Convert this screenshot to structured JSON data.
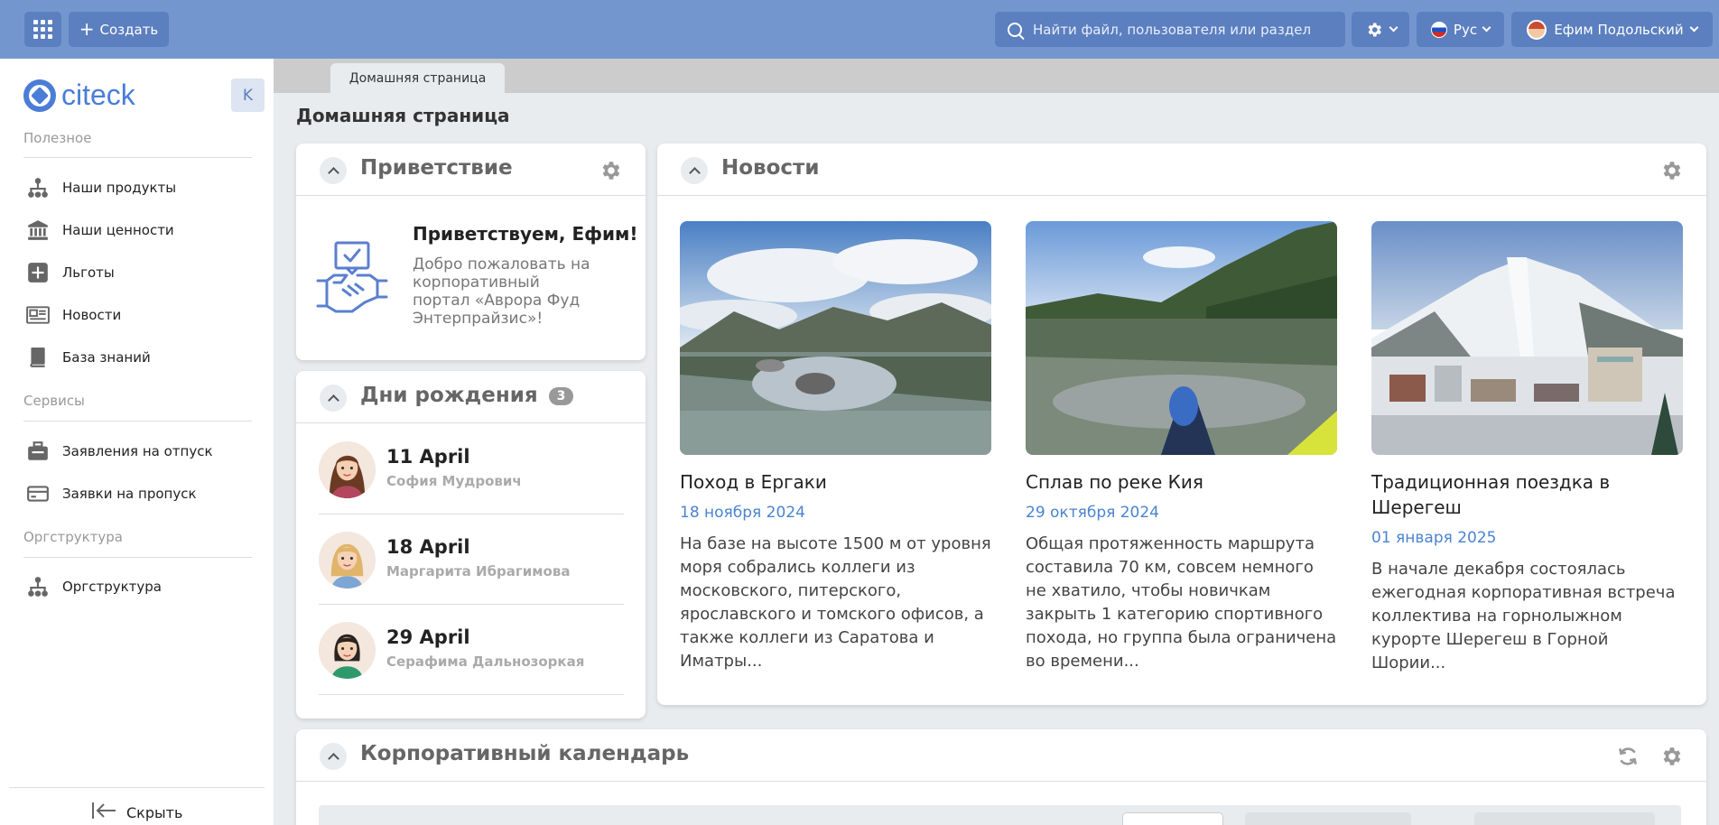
{
  "topbar": {
    "create_label": "Создать",
    "search_placeholder": "Найти файл, пользователя или раздел",
    "language": "Рус",
    "user_name": "Ефим Подольский"
  },
  "sidebar": {
    "logo_text": "citeck",
    "collapse_letter": "K",
    "sections": [
      {
        "title": "Полезное",
        "items": [
          {
            "label": "Наши продукты",
            "icon": "org-structure-icon"
          },
          {
            "label": "Наши ценности",
            "icon": "bank-icon"
          },
          {
            "label": "Льготы",
            "icon": "plus-square-icon"
          },
          {
            "label": "Новости",
            "icon": "newspaper-icon"
          },
          {
            "label": "База знаний",
            "icon": "book-icon"
          }
        ]
      },
      {
        "title": "Сервисы",
        "items": [
          {
            "label": "Заявления на отпуск",
            "icon": "suitcase-icon"
          },
          {
            "label": "Заявки на пропуск",
            "icon": "card-icon"
          }
        ]
      },
      {
        "title": "Оргструктура",
        "items": [
          {
            "label": "Оргструктура",
            "icon": "org-structure-icon"
          }
        ]
      }
    ],
    "hide_label": "Скрыть"
  },
  "tabs": [
    {
      "label": "Домашняя страница"
    }
  ],
  "page_title": "Домашняя страница",
  "welcome": {
    "title": "Приветствие",
    "heading": "Приветствуем, Ефим!",
    "text": "Добро пожаловать на корпоративный портал «Аврора Фуд Энтерпрайзис»!"
  },
  "birthdays": {
    "title": "Дни рождения",
    "count": "3",
    "items": [
      {
        "date": "11 April",
        "name": "София Мудрович"
      },
      {
        "date": "18 April",
        "name": "Маргарита Ибрагимова"
      },
      {
        "date": "29 April",
        "name": "Серафима Дальнозоркая"
      }
    ]
  },
  "news": {
    "title": "Новости",
    "items": [
      {
        "title": "Поход в Ергаки",
        "date": "18 ноября 2024",
        "text": "На базе на высоте 1500 м от уровня моря собрались коллеги из московского, питерского, ярославского и томского офисов, а также коллеги из Саратова и Иматры..."
      },
      {
        "title": "Сплав по реке Кия",
        "date": "29 октября 2024",
        "text": "Общая протяженность маршрута составила 70 км, совсем немного не хватило, чтобы новичкам закрыть 1 категорию спортивного похода, но группа была ограничена во времени..."
      },
      {
        "title": "Традиционная поездка в Шерегеш",
        "date": "01 января 2025",
        "text": "В начале декабря состоялась ежегодная корпоративная встреча коллектива на горнолыжном курорте Шерегеш в Горной Шории..."
      }
    ]
  },
  "calendar": {
    "title": "Корпоративный календарь"
  }
}
